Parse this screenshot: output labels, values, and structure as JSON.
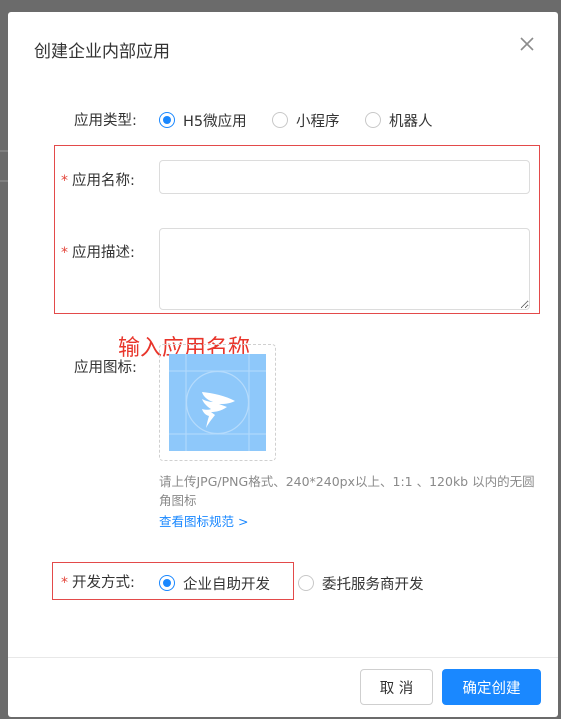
{
  "dialog": {
    "title": "创建企业内部应用",
    "close_icon": "close-icon"
  },
  "app_type": {
    "label": "应用类型:",
    "options": [
      {
        "label": "H5微应用",
        "selected": true
      },
      {
        "label": "小程序",
        "selected": false
      },
      {
        "label": "机器人",
        "selected": false
      }
    ]
  },
  "app_name": {
    "required_mark": "*",
    "label": "应用名称:",
    "value": "",
    "placeholder": ""
  },
  "app_desc": {
    "required_mark": "*",
    "label": "应用描述:",
    "value": "",
    "placeholder": ""
  },
  "annotation": "输入应用名称",
  "app_icon": {
    "label": "应用图标:",
    "logo_icon": "dingtalk-logo-icon",
    "hint": "请上传JPG/PNG格式、240*240px以上、1:1 、120kb 以内的无圆角图标",
    "link": "查看图标规范 >"
  },
  "dev_mode": {
    "required_mark": "*",
    "label": "开发方式:",
    "options": [
      {
        "label": "企业自助开发",
        "selected": true
      },
      {
        "label": "委托服务商开发",
        "selected": false
      }
    ]
  },
  "footer": {
    "cancel_label": "取 消",
    "confirm_label": "确定创建"
  },
  "colors": {
    "primary": "#1a88ff",
    "annotation_red": "#e8352b",
    "required_red": "#e3453a"
  }
}
